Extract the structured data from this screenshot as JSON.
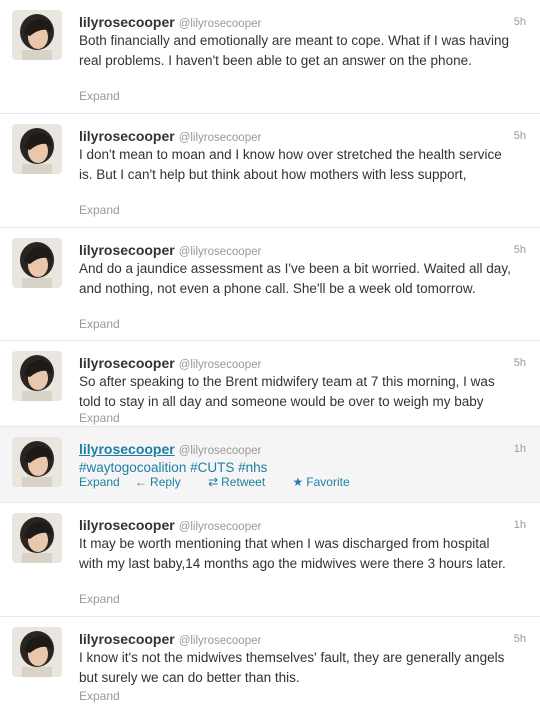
{
  "tweets": [
    {
      "username": "lilyrosecooper",
      "handle": "@lilyrosecooper",
      "time": "5h",
      "text": "Both financially and emotionally are meant to cope. What if I was having real problems. I haven't been able to get an answer on the phone.",
      "expand": "Expand"
    },
    {
      "username": "lilyrosecooper",
      "handle": "@lilyrosecooper",
      "time": "5h",
      "text": "I don't mean to moan and I know how over stretched the health service is. But I can't help but think about how mothers with less support,",
      "expand": "Expand"
    },
    {
      "username": "lilyrosecooper",
      "handle": "@lilyrosecooper",
      "time": "5h",
      "text": "And do a jaundice assessment as I've been a bit worried. Waited all day, and nothing, not even a phone call. She'll be a week old tomorrow.",
      "expand": "Expand"
    },
    {
      "username": "lilyrosecooper",
      "handle": "@lilyrosecooper",
      "time": "5h",
      "text": "So after speaking to the Brent midwifery team at 7 this morning, I was told to stay in all day and someone would be over to weigh my baby",
      "expand": "Expand"
    },
    {
      "username": "lilyrosecooper",
      "handle": "@lilyrosecooper",
      "time": "1h",
      "text": "#waytogocoalition #CUTS #nhs",
      "expand": "Expand",
      "reply": "Reply",
      "retweet": "Retweet",
      "favorite": "Favorite"
    },
    {
      "username": "lilyrosecooper",
      "handle": "@lilyrosecooper",
      "time": "1h",
      "text": "It may be worth mentioning that when I was discharged from hospital with my last baby,14 months ago the midwives were there 3 hours later.",
      "expand": "Expand"
    },
    {
      "username": "lilyrosecooper",
      "handle": "@lilyrosecooper",
      "time": "5h",
      "text": "I know it's not the midwives themselves' fault, they are generally angels but surely we can do better than this.",
      "expand": "Expand"
    }
  ],
  "colors": {
    "text": "#333333",
    "meta": "#999999",
    "link": "#1d7fa6",
    "highlight_bg": "#f5f5f5"
  },
  "icons": {
    "reply": "reply-arrow-icon",
    "retweet": "retweet-icon",
    "favorite": "star-icon"
  }
}
